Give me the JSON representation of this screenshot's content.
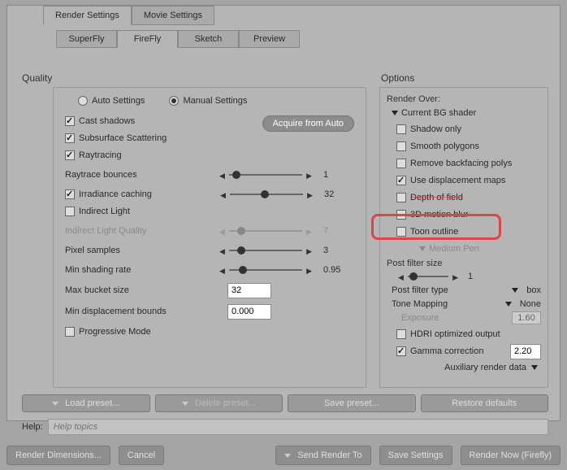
{
  "main_tabs": {
    "render": "Render Settings",
    "movie": "Movie Settings"
  },
  "sub_tabs": {
    "superfly": "SuperFly",
    "firefly": "FireFly",
    "sketch": "Sketch",
    "preview": "Preview"
  },
  "quality": {
    "title": "Quality",
    "auto": "Auto Settings",
    "manual": "Manual Settings",
    "acquire": "Acquire from Auto",
    "cast_shadows": "Cast shadows",
    "subsurface": "Subsurface Scattering",
    "raytracing": "Raytracing",
    "raytrace_bounces": {
      "label": "Raytrace bounces",
      "value": "1"
    },
    "irradiance": {
      "label": "Irradiance caching",
      "value": "32"
    },
    "indirect_light": "Indirect Light",
    "indirect_light_q": {
      "label": "Indirect Light Quality",
      "value": "7"
    },
    "pixel_samples": {
      "label": "Pixel samples",
      "value": "3"
    },
    "min_shading": {
      "label": "Min shading rate",
      "value": "0.95"
    },
    "max_bucket": {
      "label": "Max bucket size",
      "value": "32"
    },
    "min_disp": {
      "label": "Min displacement bounds",
      "value": "0.000"
    },
    "progressive": "Progressive Mode"
  },
  "options": {
    "title": "Options",
    "render_over": "Render Over:",
    "current_bg": "Current BG shader",
    "shadow_only": "Shadow only",
    "smooth_polys": "Smooth polygons",
    "remove_backfacing": "Remove backfacing polys",
    "use_disp": "Use displacement maps",
    "dof": "Depth of field",
    "motion_blur": "3D motion blur",
    "toon": "Toon outline",
    "medium_pen": "Medium Pen",
    "post_filter_size": {
      "label": "Post filter size",
      "value": "1"
    },
    "post_filter_type": {
      "label": "Post filter type",
      "value": "box"
    },
    "tone_mapping": {
      "label": "Tone Mapping",
      "value": "None"
    },
    "exposure": {
      "label": "Exposure",
      "value": "1.60"
    },
    "hdri": "HDRI optimized output",
    "gamma": {
      "label": "Gamma correction",
      "value": "2.20"
    },
    "aux": "Auxiliary render data"
  },
  "presets": {
    "load": "Load preset...",
    "delete": "Delete preset...",
    "save": "Save preset...",
    "restore": "Restore defaults"
  },
  "help": {
    "label": "Help:",
    "placeholder": "Help topics"
  },
  "bottom": {
    "dims": "Render Dimensions...",
    "cancel": "Cancel",
    "send": "Send Render To",
    "save": "Save Settings",
    "render": "Render Now (Firefly)"
  }
}
